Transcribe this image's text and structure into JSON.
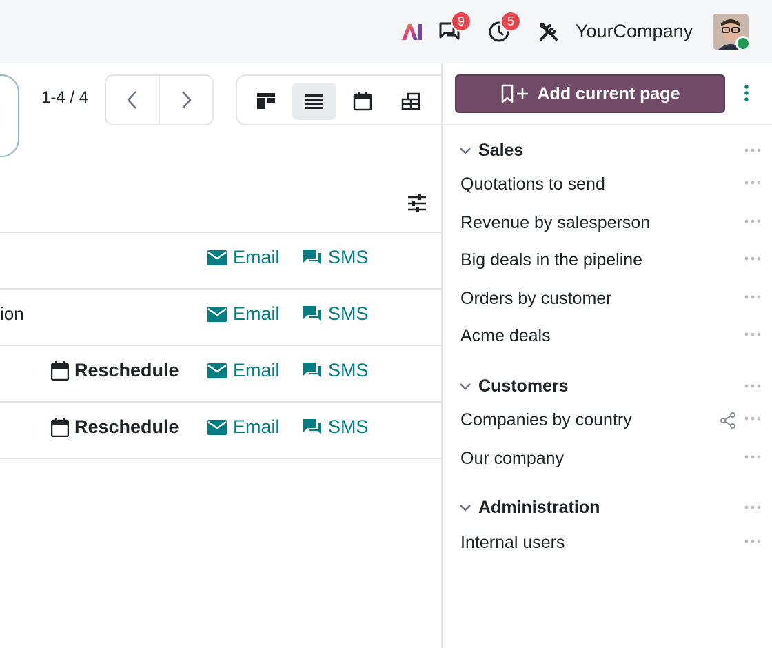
{
  "topbar": {
    "ai_label": "AI",
    "messages_badge": "9",
    "activities_badge": "5",
    "company": "YourCompany",
    "icons": [
      "ai-icon",
      "chat-icon",
      "clock-icon",
      "tools-icon"
    ]
  },
  "toolbar": {
    "pager": "1-4 / 4",
    "views": [
      "kanban-view",
      "list-view",
      "calendar-view",
      "pivot-view"
    ],
    "active_view": "list-view"
  },
  "rows": [
    {
      "text": "",
      "reschedule": "",
      "email": "Email",
      "sms": "SMS"
    },
    {
      "text": "ion",
      "reschedule": "",
      "email": "Email",
      "sms": "SMS"
    },
    {
      "text": "",
      "reschedule": "Reschedule",
      "email": "Email",
      "sms": "SMS"
    },
    {
      "text": "",
      "reschedule": "Reschedule",
      "email": "Email",
      "sms": "SMS"
    }
  ],
  "panel": {
    "add_button": "Add current page",
    "groups": [
      {
        "title": "Sales",
        "items": [
          "Quotations to send",
          "Revenue by salesperson",
          "Big deals in the pipeline",
          "Orders by customer",
          "Acme deals"
        ]
      },
      {
        "title": "Customers",
        "items": [
          "Companies by country",
          "Our company"
        ]
      },
      {
        "title": "Administration",
        "items": [
          "Internal users"
        ]
      }
    ]
  },
  "colors": {
    "accent_teal": "#017e84",
    "brand_purple": "#714b67",
    "badge_red": "#e6444b",
    "presence_green": "#1f9d55"
  }
}
